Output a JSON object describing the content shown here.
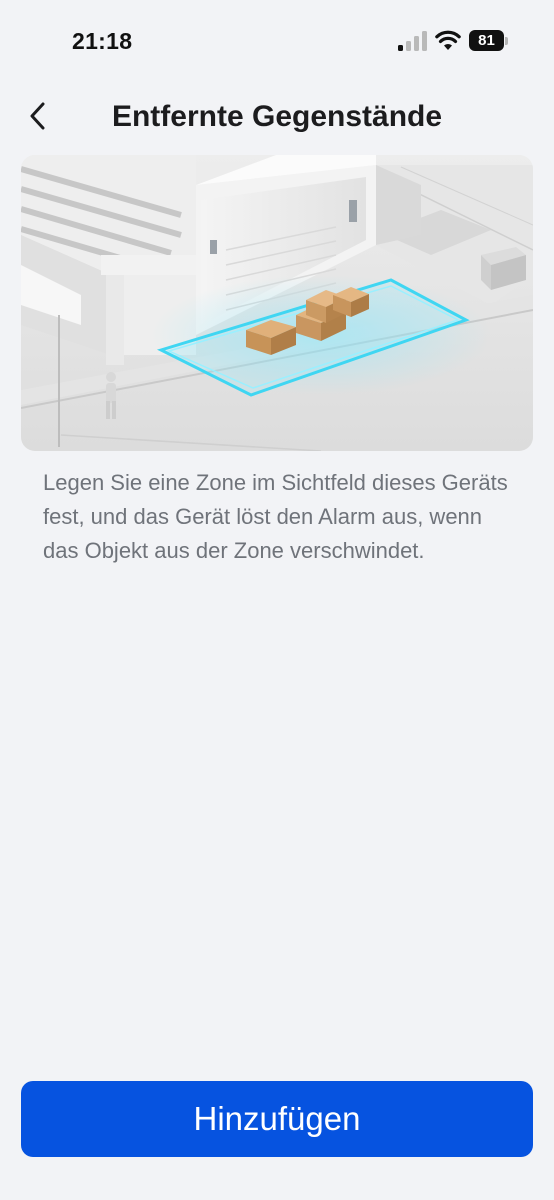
{
  "status_bar": {
    "time": "21:18",
    "battery_level": "81",
    "icons": [
      "cellular-signal-icon",
      "wifi-icon",
      "battery-icon"
    ]
  },
  "nav": {
    "back_icon": "chevron-left-icon",
    "title": "Entfernte Gegenstände"
  },
  "illustration": {
    "subject": "warehouse-zone-illustration",
    "zone_color": "#3fd6f2"
  },
  "description": "Legen Sie eine Zone im Sichtfeld dieses Geräts fest, und das Gerät löst den Alarm aus, wenn das Objekt aus der Zone verschwindet.",
  "footer": {
    "add_label": "Hinzufügen"
  },
  "colors": {
    "background": "#f2f3f6",
    "primary_button": "#0653e0",
    "description_text": "#6f737a"
  }
}
